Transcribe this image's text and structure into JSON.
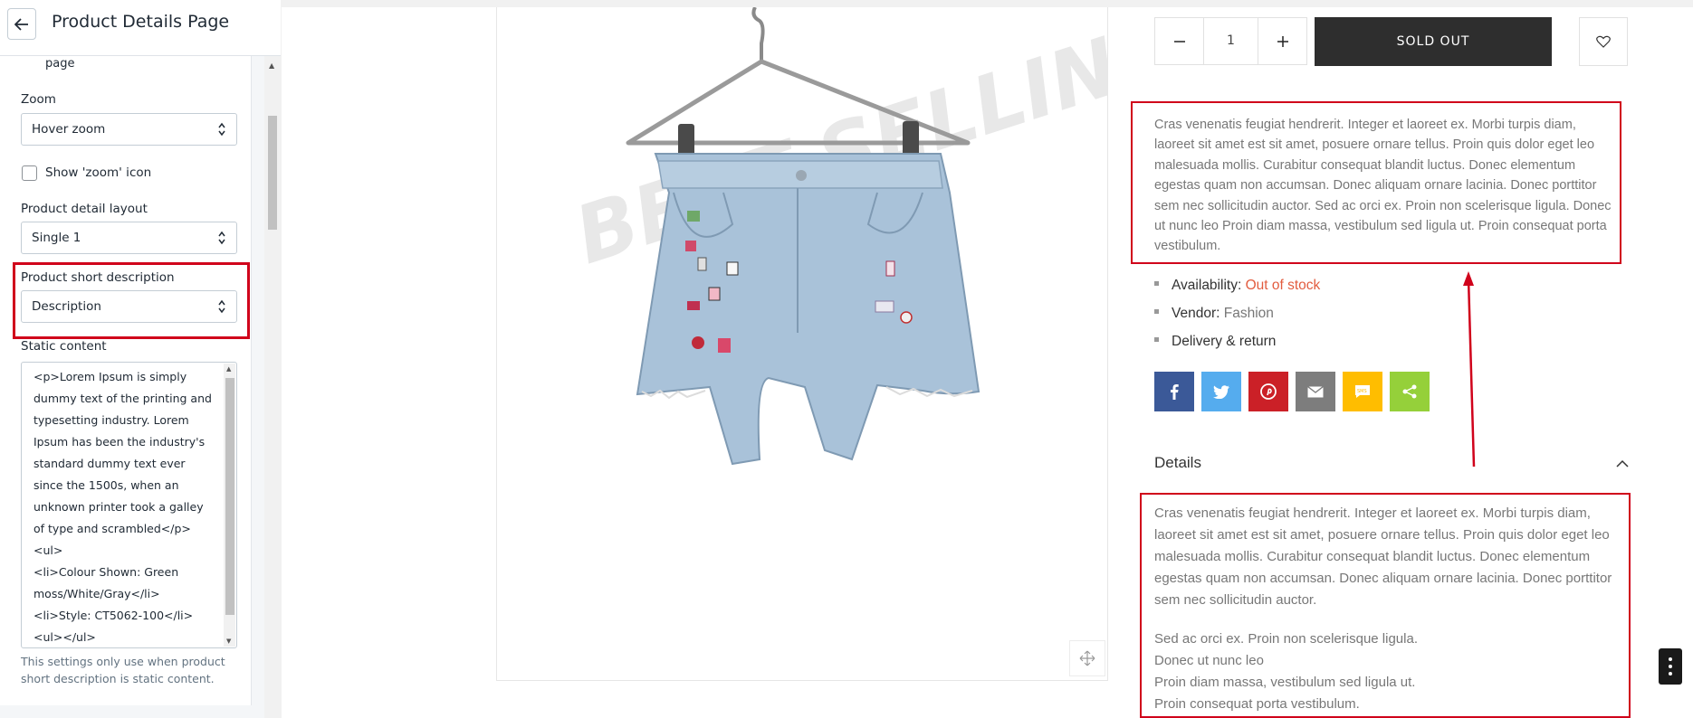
{
  "header": {
    "title": "Product Details Page"
  },
  "settings": {
    "partial_top_text": "page",
    "zoom": {
      "label": "Zoom",
      "value": "Hover zoom"
    },
    "show_zoom_icon": {
      "label": "Show 'zoom' icon",
      "checked": false
    },
    "layout": {
      "label": "Product detail layout",
      "value": "Single 1"
    },
    "short_description": {
      "label": "Product short description",
      "value": "Description"
    },
    "static_content": {
      "label": "Static content",
      "lines": [
        "<p>Lorem Ipsum is simply",
        "dummy text of the printing and",
        "typesetting industry. Lorem",
        "Ipsum has been the industry's",
        "standard dummy text ever",
        "since the 1500s, when an",
        "unknown printer took a galley",
        "of type and scrambled</p>",
        "<ul>",
        "<li>Colour Shown: Green",
        "moss/White/Gray</li>",
        "<li>Style: CT5062-100</li>",
        "<ul></ul>"
      ],
      "help": "This settings only use when product short description is static content."
    }
  },
  "product": {
    "watermark": "BEST SELLING",
    "quantity": "1",
    "sold_out_label": "SOLD OUT",
    "short_description": "Cras venenatis feugiat hendrerit. Integer et laoreet ex. Morbi turpis diam, laoreet sit amet est sit amet, posuere ornare tellus. Proin quis dolor eget leo malesuada mollis. Curabitur consequat blandit luctus. Donec elementum egestas quam non accumsan. Donec aliquam ornare lacinia. Donec porttitor sem nec sollicitudin auctor. Sed ac orci ex. Proin non scelerisque ligula. Donec ut nunc leo Proin diam massa, vestibulum sed ligula ut. Proin consequat porta vestibulum.",
    "availability": {
      "label": "Availability:",
      "value": "Out of stock"
    },
    "vendor": {
      "label": "Vendor:",
      "value": "Fashion"
    },
    "delivery": "Delivery & return",
    "share_buttons": [
      {
        "name": "facebook",
        "glyph": "f",
        "color": "#3b5998"
      },
      {
        "name": "twitter",
        "glyph": "",
        "color": "#55acee"
      },
      {
        "name": "pinterest",
        "glyph": "",
        "color": "#cb2027"
      },
      {
        "name": "email",
        "glyph": "",
        "color": "#7d7d7d"
      },
      {
        "name": "sms",
        "glyph": "",
        "color": "#ffbd00"
      },
      {
        "name": "share",
        "glyph": "",
        "color": "#95d03a"
      }
    ],
    "details": {
      "title": "Details",
      "paragraph1": "Cras venenatis feugiat hendrerit. Integer et laoreet ex. Morbi turpis diam, laoreet sit amet est sit amet, posuere ornare tellus. Proin quis dolor eget leo malesuada mollis. Curabitur consequat blandit luctus. Donec elementum egestas quam non accumsan. Donec aliquam ornare lacinia. Donec porttitor sem nec sollicitudin auctor.",
      "lines": [
        "Sed ac orci ex. Proin non scelerisque ligula.",
        "Donec ut nunc leo",
        "Proin diam massa, vestibulum sed ligula ut.",
        "Proin consequat porta vestibulum."
      ]
    }
  },
  "colors": {
    "highlight": "#d0021b",
    "out_of_stock": "#e25c3f",
    "button_dark": "#2e2e2e"
  }
}
